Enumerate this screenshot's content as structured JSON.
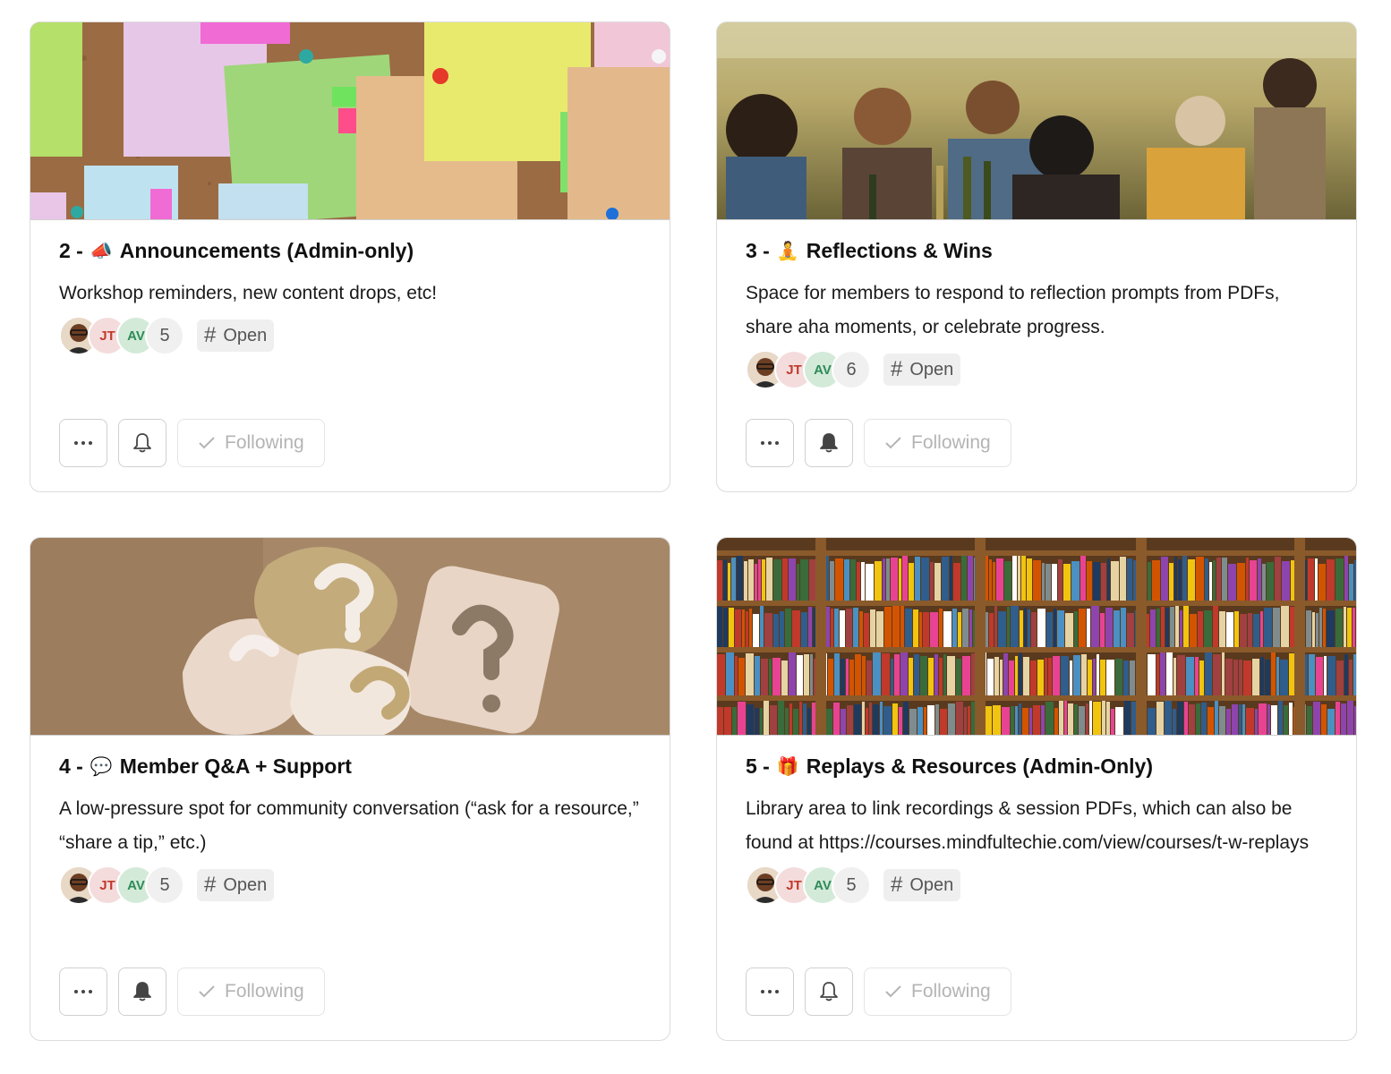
{
  "cards": [
    {
      "number": "2 -",
      "emoji": "📣",
      "title": "Announcements (Admin-only)",
      "description": "Workshop reminders, new content drops, etc!",
      "avatars": [
        "photo",
        "JT",
        "AV"
      ],
      "member_count": "5",
      "badge_label": "Open",
      "follow_label": "Following",
      "bell_state": "outline"
    },
    {
      "number": "3 -",
      "emoji": "🧘",
      "title": "Reflections & Wins",
      "description": "Space for members to respond to reflection prompts from PDFs, share aha moments, or celebrate progress.",
      "avatars": [
        "photo",
        "JT",
        "AV"
      ],
      "member_count": "6",
      "badge_label": "Open",
      "follow_label": "Following",
      "bell_state": "filled"
    },
    {
      "number": "4 -",
      "emoji": "💬",
      "title": "Member Q&A + Support",
      "description": "A low-pressure spot for community conversation (“ask for a resource,” “share a tip,” etc.)",
      "avatars": [
        "photo",
        "JT",
        "AV"
      ],
      "member_count": "5",
      "badge_label": "Open",
      "follow_label": "Following",
      "bell_state": "filled"
    },
    {
      "number": "5 -",
      "emoji": "🎁",
      "title": "Replays & Resources (Admin-Only)",
      "description": "Library area to link recordings & session PDFs, which can also be found at https://courses.mindfultechie.com/view/courses/t-w-replays",
      "avatars": [
        "photo",
        "JT",
        "AV"
      ],
      "member_count": "5",
      "badge_label": "Open",
      "follow_label": "Following",
      "bell_state": "outline"
    }
  ],
  "icons": {
    "more": "more-icon",
    "bell": "bell-icon",
    "check": "check-icon",
    "hash": "hash-icon"
  },
  "colors": {
    "card_border": "#dcdcdc",
    "badge_bg": "#efefef",
    "follow_text": "#b4b4b4",
    "avatar_jt": "#c0392b",
    "avatar_av": "#2e8b57"
  }
}
